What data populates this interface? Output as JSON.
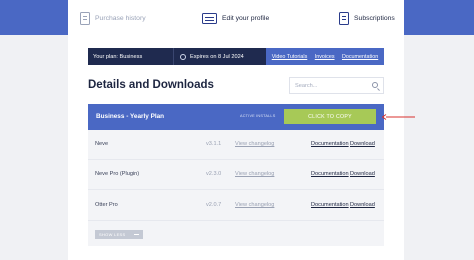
{
  "nav": {
    "purchase_history": "Purchase history",
    "edit_profile": "Edit your profile",
    "subscriptions": "Subscriptions"
  },
  "plan_bar": {
    "plan": "Your plan: Business",
    "expires": "Expires on 8 Jul 2024",
    "links": [
      "Video Tutorials",
      "Invoices",
      "Documentation"
    ]
  },
  "section": {
    "title": "Details and Downloads",
    "search_placeholder": "Search..."
  },
  "product": {
    "name": "Business - Yearly Plan",
    "active_installs": "ACTIVE INSTALLS",
    "copy_button": "CLICK TO COPY"
  },
  "rows": [
    {
      "name": "Neve",
      "version": "v3.1.1",
      "changelog": "View changelog",
      "doc": "Documentation",
      "download": "Download"
    },
    {
      "name": "Neve Pro (Plugin)",
      "version": "v2.3.0",
      "changelog": "View changelog",
      "doc": "Documentation",
      "download": "Download"
    },
    {
      "name": "Otter Pro",
      "version": "v2.0.7",
      "changelog": "View changelog",
      "doc": "Documentation",
      "download": "Download"
    }
  ],
  "show_less": "SHOW LESS",
  "colors": {
    "accent": "#4a68c4",
    "dark": "#1f2a4f",
    "copy_button": "#a7c957",
    "arrow": "#d9302c"
  }
}
